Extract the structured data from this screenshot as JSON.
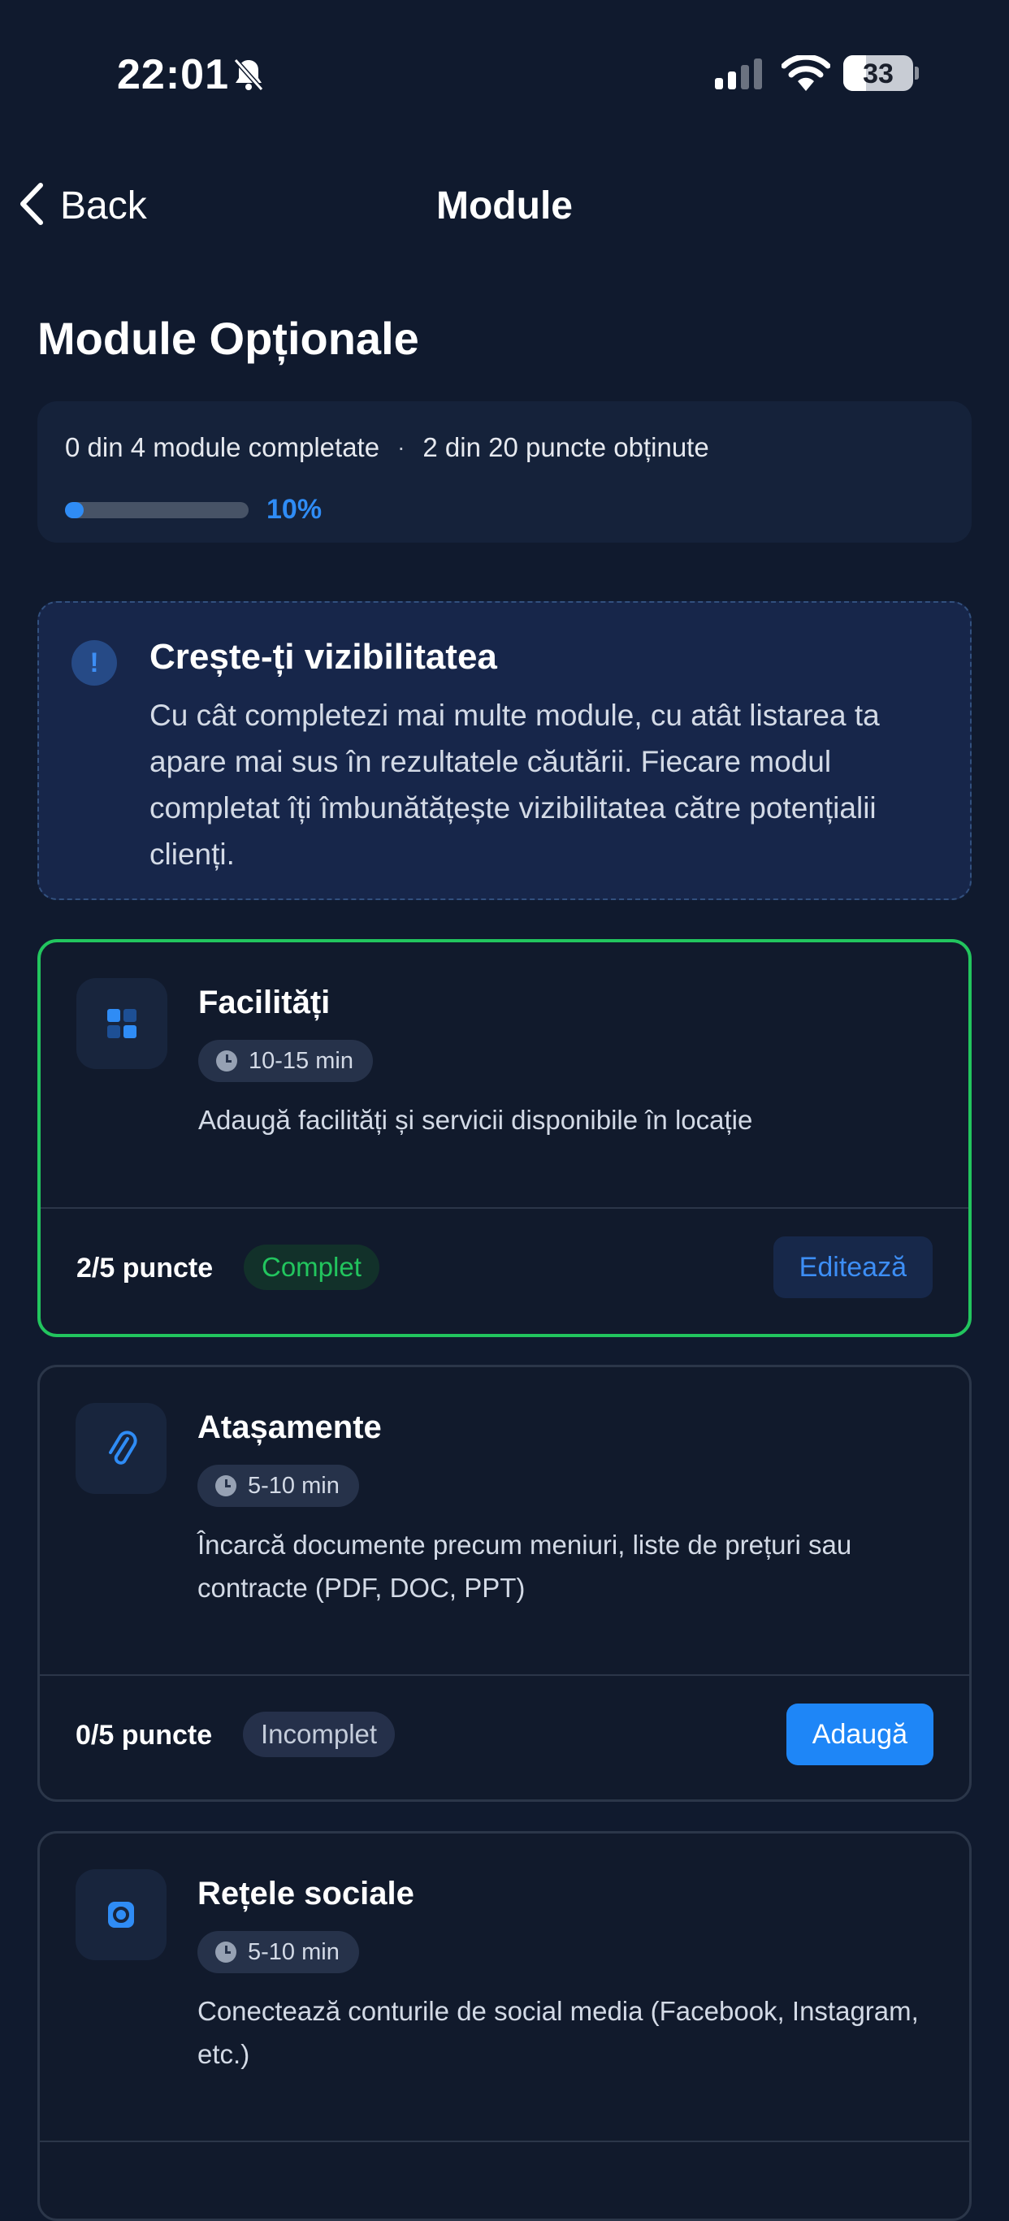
{
  "status_bar": {
    "time": "22:01",
    "battery": "33",
    "battery_level": 0.33,
    "icons": [
      "bell-slash-icon",
      "cellular-signal-icon",
      "wifi-icon",
      "battery-icon"
    ]
  },
  "nav": {
    "back_label": "Back",
    "title": "Module"
  },
  "page_title": "Module Opționale",
  "progress": {
    "modules_text": "0 din 4 module completate",
    "separator": "·",
    "points_text": "2 din 20 puncte obținute",
    "percent_label": "10%",
    "percent": 10
  },
  "info": {
    "icon": "exclamation-icon",
    "title": "Crește-ți vizibilitatea",
    "body": "Cu cât completezi mai multe module, cu atât listarea ta apare mai sus în rezultatele căutării. Fiecare modul completat îți îmbunătățește vizibilitatea către potențialii clienți."
  },
  "modules": [
    {
      "icon": "grid-icon",
      "name": "Facilități",
      "time": "10-15 min",
      "description": "Adaugă facilități și servicii disponibile în locație",
      "points": "2/5 puncte",
      "status": "Complet",
      "action": "Editează"
    },
    {
      "icon": "paperclip-icon",
      "name": "Atașamente",
      "time": "5-10 min",
      "description": "Încarcă documente precum meniuri, liste de prețuri sau contracte (PDF, DOC, PPT)",
      "points": "0/5 puncte",
      "status": "Incomplet",
      "action": "Adaugă"
    },
    {
      "icon": "instagram-icon",
      "name": "Rețele sociale",
      "time": "5-10 min",
      "description": "Conectează conturile de social media (Facebook, Instagram, etc.)"
    }
  ],
  "colors": {
    "background": "#101a2e",
    "accent": "#1e86f7",
    "complete": "#22c55e"
  }
}
